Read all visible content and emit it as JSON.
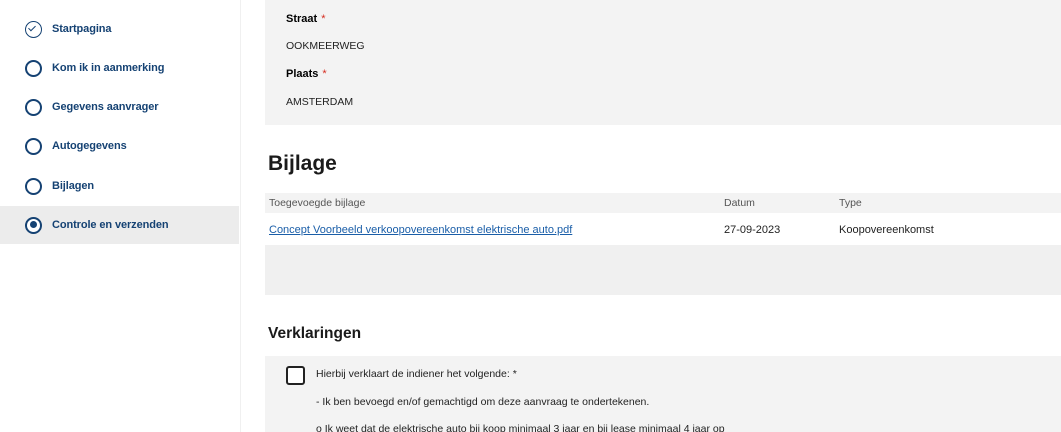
{
  "sidebar": {
    "steps": [
      {
        "label": "Startpagina",
        "state": "done"
      },
      {
        "label": "Kom ik in aanmerking",
        "state": "todo"
      },
      {
        "label": "Gegevens aanvrager",
        "state": "todo"
      },
      {
        "label": "Autogegevens",
        "state": "todo"
      },
      {
        "label": "Bijlagen",
        "state": "todo"
      },
      {
        "label": "Controle en verzenden",
        "state": "active"
      }
    ]
  },
  "address": {
    "straat_label": "Straat",
    "straat_value": "OOKMEERWEG",
    "plaats_label": "Plaats",
    "plaats_value": "AMSTERDAM",
    "required_mark": "*"
  },
  "bijlage": {
    "title": "Bijlage",
    "headers": {
      "file": "Toegevoegde bijlage",
      "date": "Datum",
      "type": "Type"
    },
    "rows": [
      {
        "file": "Concept Voorbeeld verkoopovereenkomst elektrische auto.pdf",
        "date": "27-09-2023",
        "type": "Koopovereenkomst"
      }
    ]
  },
  "verklaringen": {
    "title": "Verklaringen",
    "lines": [
      "Hierbij verklaart de indiener het volgende: *",
      "- Ik ben bevoegd en/of gemachtigd om deze aanvraag te ondertekenen.",
      "o Ik weet dat de elektrische auto bij koop minimaal 3 jaar en bij lease minimaal 4 jaar op"
    ]
  },
  "colors": {
    "accent": "#154273",
    "link": "#1a5ea8",
    "required": "#d52b1e",
    "panel": "#f3f3f3"
  }
}
